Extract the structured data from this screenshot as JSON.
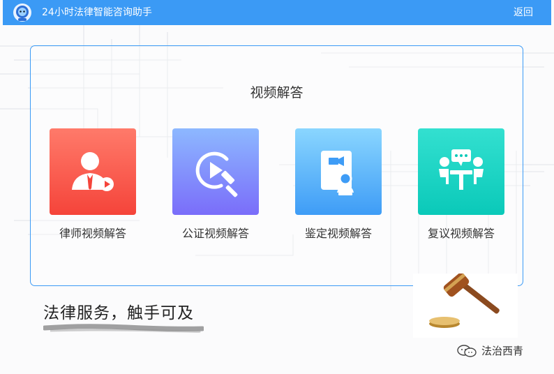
{
  "header": {
    "logo_icon": "robot-avatar-icon",
    "title": "24小时法律智能咨询助手",
    "back_label": "返回",
    "bg_color": "#3b9af5"
  },
  "panel": {
    "title": "视频解答",
    "border_color": "#3b9af5",
    "items": [
      {
        "label": "律师视频解答",
        "icon": "lawyer-video-icon",
        "color": "#f5443a"
      },
      {
        "label": "公证视频解答",
        "icon": "notary-play-gavel-icon",
        "color": "#7a6dfa"
      },
      {
        "label": "鉴定视频解答",
        "icon": "appraisal-document-icon",
        "color": "#3e9cf6"
      },
      {
        "label": "复议视频解答",
        "icon": "meeting-discussion-icon",
        "color": "#0ac9b9"
      }
    ]
  },
  "footer": {
    "slogan": "法律服务，触手可及",
    "decor_icon": "gavel-icon",
    "watermark": {
      "icon": "wechat-icon",
      "text": "法治西青"
    }
  }
}
